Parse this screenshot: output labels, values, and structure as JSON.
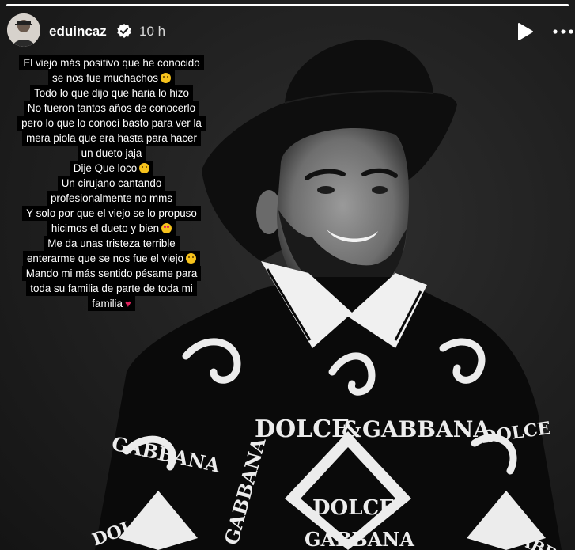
{
  "header": {
    "username": "eduincaz",
    "time": "10 h",
    "verified": true,
    "icons": {
      "avatar": "profile-photo",
      "verified": "verified-badge-icon",
      "play": "play-icon",
      "more": "more-options-icon"
    }
  },
  "story": {
    "progress": 1.0,
    "caption_lines": [
      {
        "text": "El viejo más positivo que he conocido",
        "emoji": ""
      },
      {
        "text": "se nos fue muchachos",
        "emoji": "pensive-face"
      },
      {
        "text": "Todo lo que dijo que haria lo hizo",
        "emoji": ""
      },
      {
        "text": "No fueron tantos años de conocerlo",
        "emoji": ""
      },
      {
        "text": "pero lo que lo conocí basto para ver la",
        "emoji": ""
      },
      {
        "text": "mera piola que era hasta para hacer",
        "emoji": ""
      },
      {
        "text": "un dueto jaja",
        "emoji": ""
      },
      {
        "text": "Dije Que loco",
        "emoji": "grinning-face"
      },
      {
        "text": "Un cirujano cantando",
        "emoji": ""
      },
      {
        "text": "profesionalmente no mms",
        "emoji": ""
      },
      {
        "text": "Y solo por que el viejo se lo propuso",
        "emoji": ""
      },
      {
        "text": "hicimos el dueto y bien",
        "emoji": "heart-eyes-face"
      },
      {
        "text": "Me da unas tristeza terrible",
        "emoji": ""
      },
      {
        "text": "enterarme que se nos fue el viejo",
        "emoji": "sad-face"
      },
      {
        "text": "Mando mi más sentido pésame para",
        "emoji": ""
      },
      {
        "text": "toda su familia de parte de toda mi",
        "emoji": ""
      },
      {
        "text": "familia",
        "emoji": "red-heart"
      }
    ],
    "photo": {
      "shirt_print_text": [
        "DOLCE",
        "&",
        "GABBANA",
        "GABBANA",
        "DOLCE",
        "GABBANA",
        "DOLCE",
        "GABBANA",
        "DOLCE"
      ]
    }
  },
  "colors": {
    "background": "#1b1b1b",
    "caption_bg": "#000000",
    "text": "#ffffff",
    "verified_blue": "#ffffff",
    "heart": "#e0245e"
  }
}
